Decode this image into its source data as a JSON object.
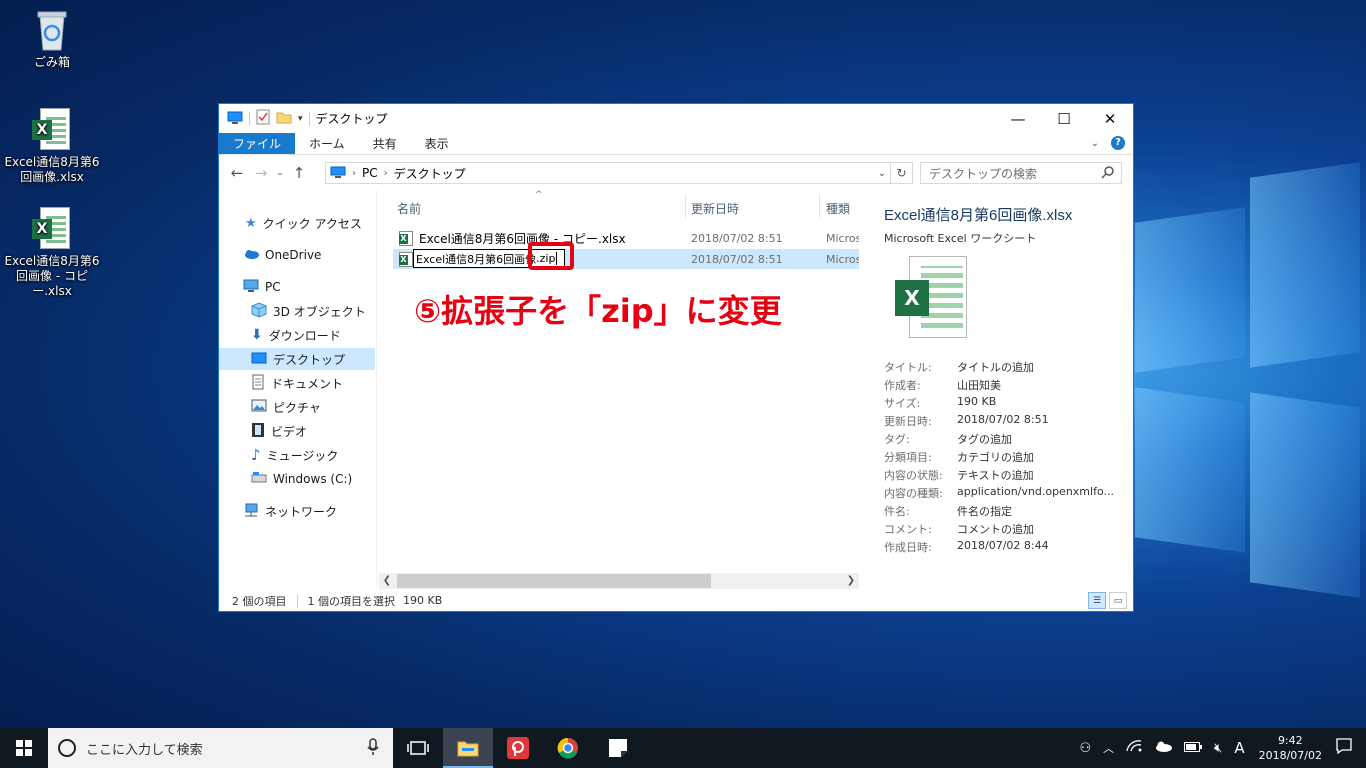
{
  "desktop": {
    "icons": [
      {
        "label": "ごみ箱"
      },
      {
        "label": "Excel通信8月第6回画像.xlsx"
      },
      {
        "label": "Excel通信8月第6回画像 - コピー.xlsx"
      }
    ]
  },
  "window": {
    "title": "デスクトップ",
    "ribbon_tabs": [
      "ファイル",
      "ホーム",
      "共有",
      "表示"
    ],
    "address": {
      "segments": [
        "PC",
        "デスクトップ"
      ]
    },
    "search_placeholder": "デスクトップの検索",
    "nav": [
      {
        "label": "クイック アクセス"
      },
      {
        "label": "OneDrive"
      },
      {
        "label": "PC"
      },
      {
        "label": "3D オブジェクト"
      },
      {
        "label": "ダウンロード"
      },
      {
        "label": "デスクトップ"
      },
      {
        "label": "ドキュメント"
      },
      {
        "label": "ピクチャ"
      },
      {
        "label": "ビデオ"
      },
      {
        "label": "ミュージック"
      },
      {
        "label": "Windows (C:)"
      },
      {
        "label": "ネットワーク"
      }
    ],
    "columns": {
      "name": "名前",
      "date": "更新日時",
      "type": "種類"
    },
    "files": [
      {
        "name": "Excel通信8月第6回画像 - コピー.xlsx",
        "date": "2018/07/02 8:51",
        "type": "Microsoft Excel ワークシート"
      },
      {
        "name_edit": "Excel通信8月第6回画像",
        "ext_edit": ".zip",
        "date": "2018/07/02 8:51",
        "type": "Microsoft Excel ワークシート"
      }
    ],
    "details": {
      "title": "Excel通信8月第6回画像.xlsx",
      "subtitle": "Microsoft Excel ワークシート",
      "props": [
        {
          "k": "タイトル:",
          "v": "タイトルの追加"
        },
        {
          "k": "作成者:",
          "v": "山田知美"
        },
        {
          "k": "サイズ:",
          "v": "190 KB"
        },
        {
          "k": "更新日時:",
          "v": "2018/07/02 8:51"
        },
        {
          "k": "タグ:",
          "v": "タグの追加"
        },
        {
          "k": "分類項目:",
          "v": "カテゴリの追加"
        },
        {
          "k": "内容の状態:",
          "v": "テキストの追加"
        },
        {
          "k": "内容の種類:",
          "v": "application/vnd.openxmlfo..."
        },
        {
          "k": "件名:",
          "v": "件名の指定"
        },
        {
          "k": "コメント:",
          "v": "コメントの追加"
        },
        {
          "k": "作成日時:",
          "v": "2018/07/02 8:44"
        }
      ]
    },
    "status": {
      "items": "2 個の項目",
      "selected": "1 個の項目を選択",
      "size": "190 KB"
    }
  },
  "annotation": {
    "text": "⑤拡張子を「zip」に変更",
    "color": "#e60012"
  },
  "taskbar": {
    "search_placeholder": "ここに入力して検索",
    "time": "9:42",
    "date": "2018/07/02",
    "ime": "A"
  },
  "colors": {
    "accent": "#1979ca",
    "selection": "#cce8ff",
    "annotation": "#e60012"
  }
}
